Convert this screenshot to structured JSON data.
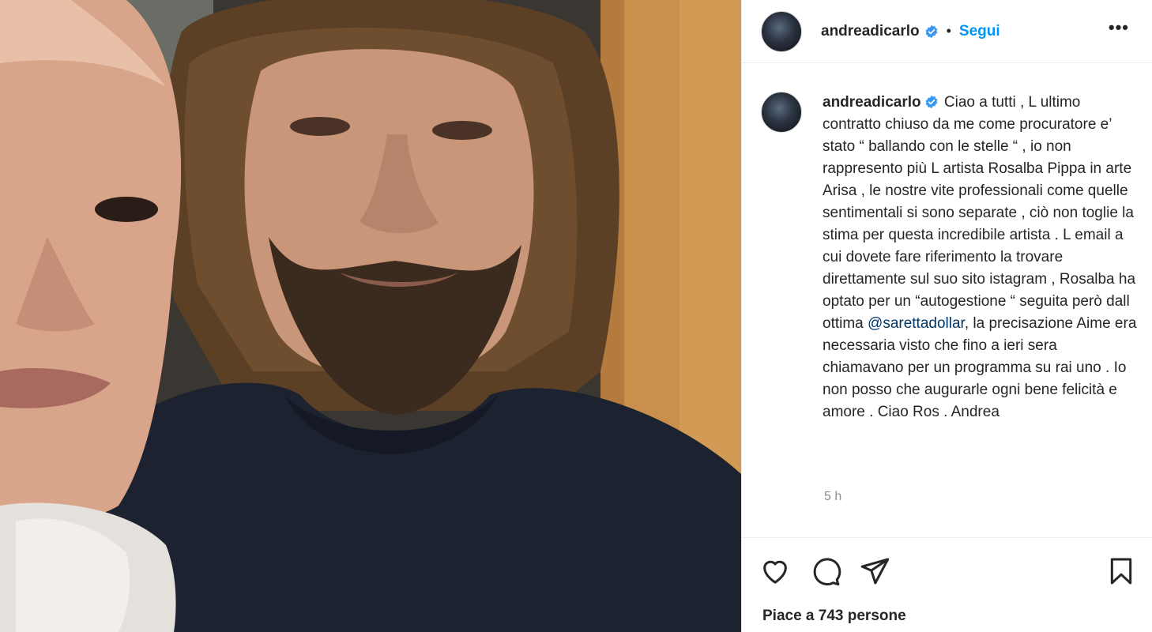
{
  "post": {
    "username": "andreadicarlo",
    "dot": "•",
    "follow_label": "Segui",
    "more_label": "•••",
    "caption_user": "andreadicarlo",
    "caption_part1": "Ciao a tutti , L ultimo contratto chiuso da me come procuratore e’ stato “ ballando con le stelle “ , io non rappresento più L artista Rosalba Pippa in arte Arisa , le nostre vite professionali come quelle sentimentali si sono separate , ciò non toglie la stima per questa incredibile artista . L email a cui dovete fare riferimento la trovare direttamente sul suo sito istagram , Rosalba ha optato per un “autogestione “ seguita però dall ottima ",
    "caption_mention": "@sarettadollar",
    "caption_part2": ", la precisazione Aime era necessaria visto che fino a ieri sera chiamavano per un programma su rai uno . Io non posso che augurarle ogni bene felicità e amore . Ciao Ros . Andrea",
    "time": "5 h",
    "likes": "Piace a 743 persone"
  },
  "icons": {
    "like": "heart-icon",
    "comment": "comment-icon",
    "share": "paper-plane-icon",
    "save": "bookmark-icon",
    "verified": "verified-badge-icon"
  },
  "colors": {
    "link": "#0095f6",
    "mention": "#00376b",
    "muted": "#8e8e8e",
    "text": "#262626"
  }
}
